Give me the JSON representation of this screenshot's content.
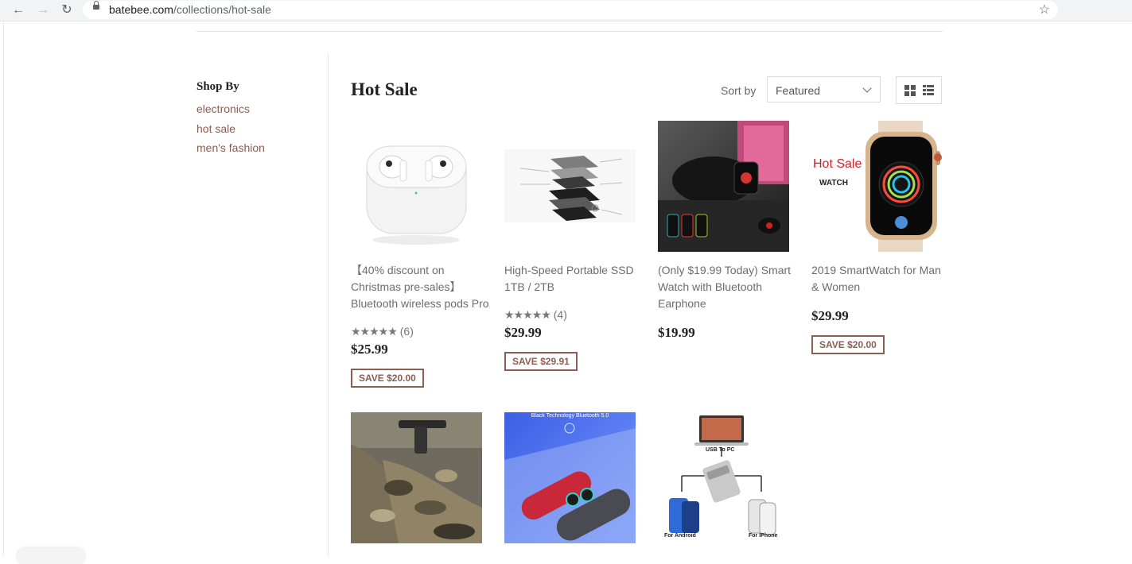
{
  "browser": {
    "url_host": "batebee.com",
    "url_path": "/collections/hot-sale"
  },
  "sidebar": {
    "title": "Shop By",
    "links": [
      "electronics",
      "hot sale",
      "men's fashion"
    ]
  },
  "collection": {
    "title": "Hot Sale",
    "sort_label": "Sort by",
    "sort_value": "Featured"
  },
  "products": [
    {
      "title": "【40% discount on Christmas pre-sales】Bluetooth wireless pods Pro",
      "rating_count": "(6)",
      "price": "$25.99",
      "save": "SAVE $20.00",
      "rating": 5
    },
    {
      "title": "High-Speed Portable SSD 1TB / 2TB",
      "rating_count": "(4)",
      "price": "$29.99",
      "save": "SAVE $29.91",
      "rating": 5
    },
    {
      "title": "(Only $19.99 Today) Smart Watch with Bluetooth Earphone",
      "price": "$19.99"
    },
    {
      "title": "2019 SmartWatch for Man & Women",
      "price": "$29.99",
      "save": "SAVE $20.00"
    }
  ],
  "image_text": {
    "watch_hot": "Hot Sale",
    "watch_sub": "WATCH",
    "bt_banner": "Black Technology Bluetooth 5.0",
    "usb_to_pc": "USB To PC",
    "for_android": "For Android",
    "for_iphone": "For IPhone"
  },
  "stars_glyph": "★★★★★"
}
